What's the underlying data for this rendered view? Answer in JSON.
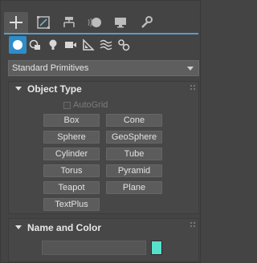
{
  "command_panel": {
    "tabs": [
      {
        "icon": "plus-create-icon",
        "active": true
      },
      {
        "icon": "modify-bracket-icon",
        "active": false
      },
      {
        "icon": "hierarchy-icon",
        "active": false
      },
      {
        "icon": "motion-icon",
        "active": false
      },
      {
        "icon": "display-monitor-icon",
        "active": false
      },
      {
        "icon": "utilities-wrench-icon",
        "active": false
      }
    ],
    "sub_tools": [
      {
        "icon": "geometry-icon",
        "active": true
      },
      {
        "icon": "shapes-icon",
        "active": false
      },
      {
        "icon": "lights-icon",
        "active": false
      },
      {
        "icon": "cameras-icon",
        "active": false
      },
      {
        "icon": "helpers-icon",
        "active": false
      },
      {
        "icon": "space-warps-icon",
        "active": false
      },
      {
        "icon": "systems-icon",
        "active": false
      }
    ],
    "category_dropdown": {
      "value": "Standard Primitives"
    }
  },
  "object_type": {
    "title": "Object Type",
    "autogrid_label": "AutoGrid",
    "buttons": [
      "Box",
      "Cone",
      "Sphere",
      "GeoSphere",
      "Cylinder",
      "Tube",
      "Torus",
      "Pyramid",
      "Teapot",
      "Plane",
      "TextPlus"
    ]
  },
  "name_and_color": {
    "title": "Name and Color",
    "name_value": "",
    "color": "#58dfcb"
  },
  "colors": {
    "accent_blue": "#2e8dc9",
    "tab_rule": "#5a9ec6",
    "panel_bg": "#444444"
  }
}
